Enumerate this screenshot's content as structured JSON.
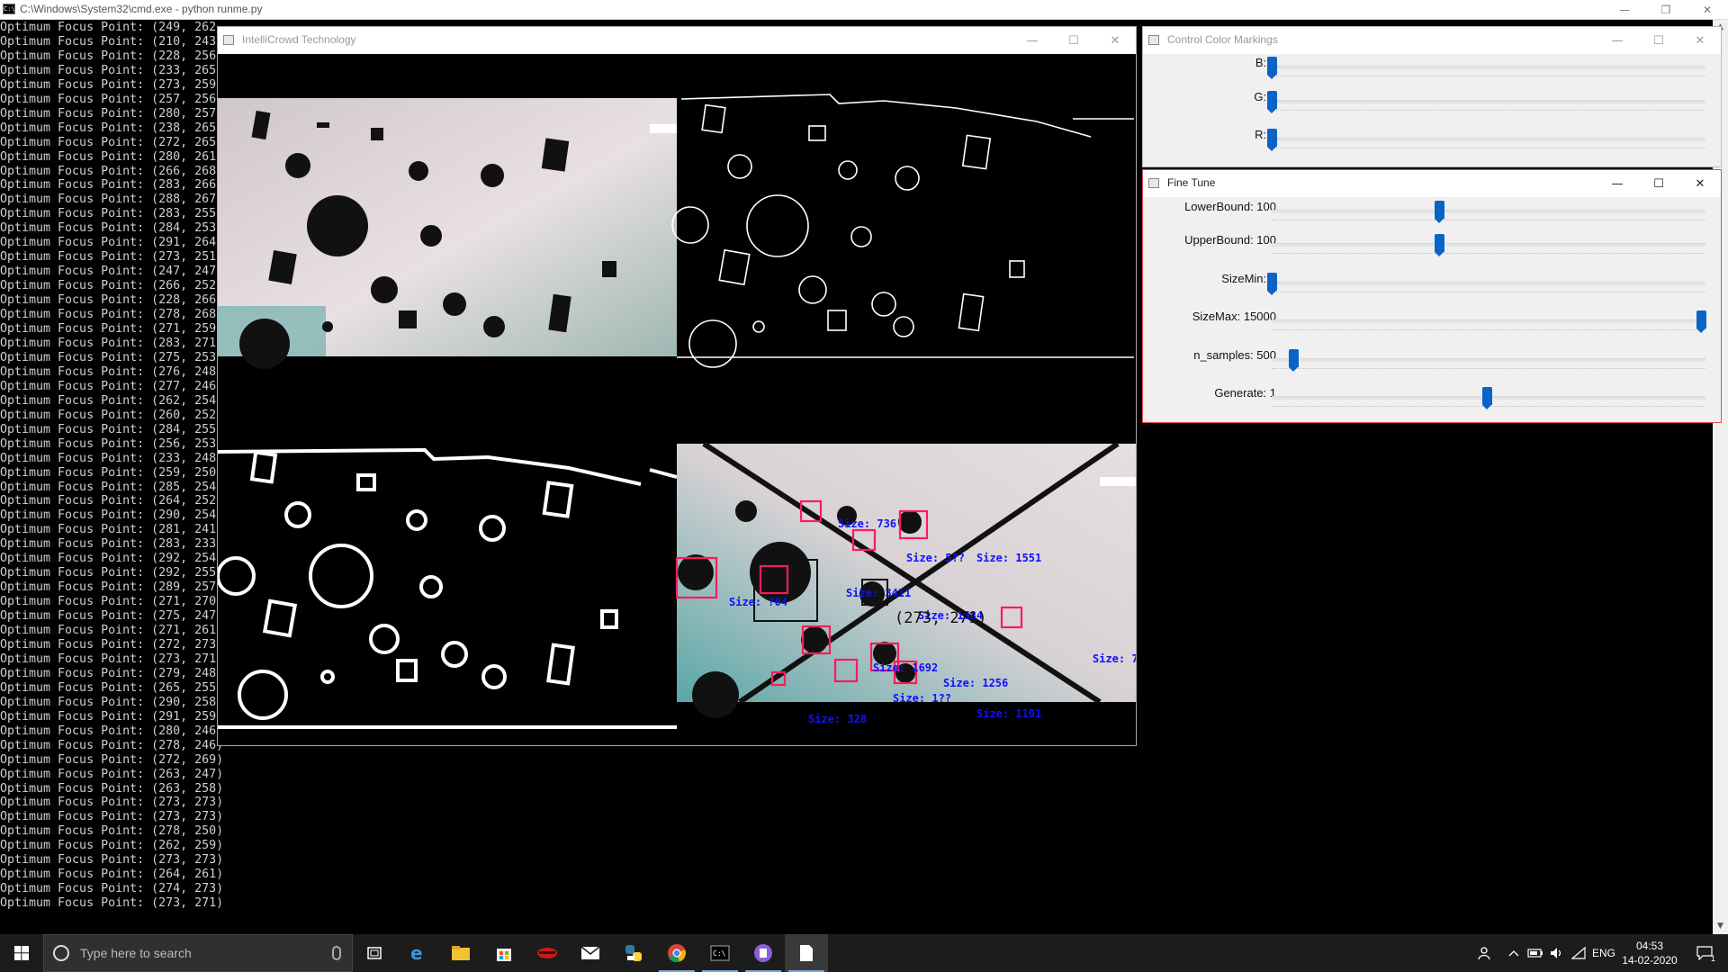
{
  "console": {
    "title": "C:\\Windows\\System32\\cmd.exe - python  runme.py",
    "lines": [
      "Optimum Focus Point: (249, 262",
      "Optimum Focus Point: (210, 243",
      "Optimum Focus Point: (228, 256",
      "Optimum Focus Point: (233, 265",
      "Optimum Focus Point: (273, 259",
      "Optimum Focus Point: (257, 256",
      "Optimum Focus Point: (280, 257",
      "Optimum Focus Point: (238, 265",
      "Optimum Focus Point: (272, 265",
      "Optimum Focus Point: (280, 261",
      "Optimum Focus Point: (266, 268",
      "Optimum Focus Point: (283, 266",
      "Optimum Focus Point: (288, 267",
      "Optimum Focus Point: (283, 255",
      "Optimum Focus Point: (284, 253",
      "Optimum Focus Point: (291, 264",
      "Optimum Focus Point: (273, 251",
      "Optimum Focus Point: (247, 247",
      "Optimum Focus Point: (266, 252",
      "Optimum Focus Point: (228, 266",
      "Optimum Focus Point: (278, 268",
      "Optimum Focus Point: (271, 259",
      "Optimum Focus Point: (283, 271",
      "Optimum Focus Point: (275, 253",
      "Optimum Focus Point: (276, 248",
      "Optimum Focus Point: (277, 246",
      "Optimum Focus Point: (262, 254",
      "Optimum Focus Point: (260, 252",
      "Optimum Focus Point: (284, 255",
      "Optimum Focus Point: (256, 253",
      "Optimum Focus Point: (233, 248",
      "Optimum Focus Point: (259, 250",
      "Optimum Focus Point: (285, 254",
      "Optimum Focus Point: (264, 252",
      "Optimum Focus Point: (290, 254",
      "Optimum Focus Point: (281, 241",
      "Optimum Focus Point: (283, 233",
      "Optimum Focus Point: (292, 254",
      "Optimum Focus Point: (292, 255",
      "Optimum Focus Point: (289, 257",
      "Optimum Focus Point: (271, 270",
      "Optimum Focus Point: (275, 247",
      "Optimum Focus Point: (271, 261",
      "Optimum Focus Point: (272, 273",
      "Optimum Focus Point: (273, 271",
      "Optimum Focus Point: (279, 248",
      "Optimum Focus Point: (265, 255",
      "Optimum Focus Point: (290, 258",
      "Optimum Focus Point: (291, 259",
      "Optimum Focus Point: (280, 246",
      "Optimum Focus Point: (278, 246)",
      "Optimum Focus Point: (272, 269)",
      "Optimum Focus Point: (263, 247)",
      "Optimum Focus Point: (263, 258)",
      "Optimum Focus Point: (273, 273)",
      "Optimum Focus Point: (273, 273)",
      "Optimum Focus Point: (278, 250)",
      "Optimum Focus Point: (262, 259)",
      "Optimum Focus Point: (273, 273)",
      "Optimum Focus Point: (264, 261)",
      "Optimum Focus Point: (274, 273)",
      "Optimum Focus Point: (273, 271)"
    ]
  },
  "intellicrowd": {
    "title": "IntelliCrowd Technology",
    "annotations": {
      "focus_point": "(273, 271)",
      "sizes": [
        "Size: 736",
        "Size: 5??",
        "Size: 1551",
        "Size: ?04",
        "Size: 3411",
        "Size: 1684",
        "Size: 1692",
        "Size: 1256",
        "Size: 1??",
        "Size: 1101",
        "Size: 328",
        "Size: 7"
      ]
    }
  },
  "control_color_markings": {
    "title": "Control Color Markings",
    "sliders": [
      {
        "label": "B: 0",
        "level": 0
      },
      {
        "label": "G: 0",
        "level": 0
      },
      {
        "label": "R: 0",
        "level": 0
      }
    ]
  },
  "fine_tune": {
    "title": "Fine Tune",
    "sliders": [
      {
        "label": "LowerBound: 100",
        "level": 0.39
      },
      {
        "label": "UpperBound: 100",
        "level": 0.39
      },
      {
        "label": "SizeMin: 0",
        "level": 0
      },
      {
        "label": "SizeMax: 15000",
        "level": 1.0
      },
      {
        "label": "n_samples: 500",
        "level": 0.05
      },
      {
        "label": "Generate: 1",
        "level": 0.5
      }
    ]
  },
  "taskbar": {
    "search_placeholder": "Type here to search",
    "language": "ENG",
    "time": "04:53",
    "date": "14-02-2020",
    "notification_count": "1"
  },
  "colors": {
    "accent": "#0a64c8",
    "focused_border": "#e04a4a",
    "box_color": "#ff1a5a",
    "label_color": "#1010ff"
  }
}
